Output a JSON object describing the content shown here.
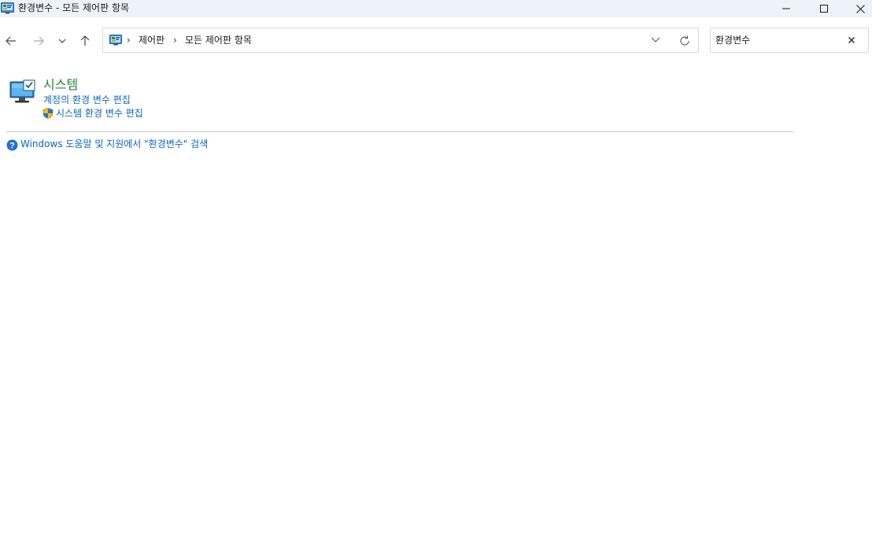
{
  "window": {
    "title": "환경변수 - 모든 제어판 항목",
    "controls": [
      "minimize",
      "maximize",
      "close"
    ]
  },
  "nav": {
    "back_icon": "arrow-left-icon",
    "forward_icon": "arrow-right-icon",
    "recent_icon": "chevron-down-icon",
    "up_icon": "arrow-up-icon"
  },
  "address": {
    "crumbs": [
      "제어판",
      "모든 제어판 항목"
    ],
    "separator": "›"
  },
  "search": {
    "value": "환경변수"
  },
  "results": {
    "category_title": "시스템",
    "tasks": [
      {
        "label": "계정의 환경 변수 편집",
        "shield": false
      },
      {
        "label": "시스템 환경 변수 편집",
        "shield": true
      }
    ]
  },
  "help": {
    "text": "Windows 도움말 및 지원에서 \"환경변수\" 검색"
  },
  "colors": {
    "category": "#267f3b",
    "link": "#0a66c2",
    "titlebar_bg": "#eef3fa"
  }
}
